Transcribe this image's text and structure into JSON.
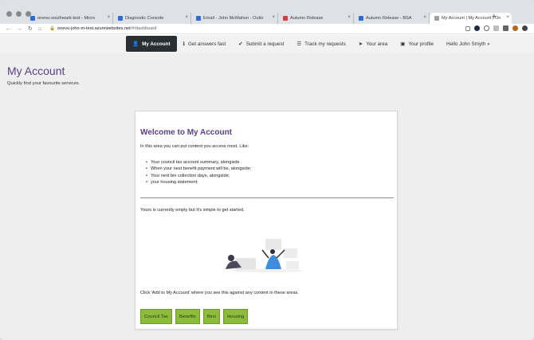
{
  "browser": {
    "tabs": [
      {
        "title": "onevu-southwark-test - Micro",
        "color": "#2f6bd8",
        "active": false
      },
      {
        "title": "Diagnostic Console",
        "color": "#2f6bd8",
        "active": false
      },
      {
        "title": "Email - John McMahon - Outlo",
        "color": "#2f6bd8",
        "active": false
      },
      {
        "title": "Autumn Release",
        "color": "#d83b3b",
        "active": false
      },
      {
        "title": "Autumn Release - BSA",
        "color": "#2f6bd8",
        "active": false
      },
      {
        "title": "My Account | My Account | On",
        "color": "#9aa0a6",
        "active": true
      }
    ],
    "close_glyph": "×",
    "new_tab_glyph": "+",
    "url_host": "onevu-john-m-test.azurewebsites.net",
    "url_path": "/#/dashboard"
  },
  "nav": {
    "items": [
      {
        "label": "My Account",
        "icon": "user-icon",
        "glyph": "👤",
        "active": true
      },
      {
        "label": "Get answers fast",
        "icon": "info-icon",
        "glyph": "ℹ",
        "active": false
      },
      {
        "label": "Submit a request",
        "icon": "check-icon",
        "glyph": "✔",
        "active": false
      },
      {
        "label": "Track my requests",
        "icon": "list-icon",
        "glyph": "☰",
        "active": false
      },
      {
        "label": "Your area",
        "icon": "location-arrow-icon",
        "glyph": "➤",
        "active": false
      },
      {
        "label": "Your profile",
        "icon": "id-card-icon",
        "glyph": "▣",
        "active": false
      }
    ],
    "greeting": "Hello John Smyth »"
  },
  "page": {
    "title": "My Account",
    "subtitle": "Quickly find your favourite services."
  },
  "card": {
    "heading": "Welcome to My Account",
    "intro": "In this area you can put content you access most. Like:",
    "list": [
      "Your council tax account summary, alongside",
      "When your next benefit payment will be, alongside;",
      "Your next bin collection days, alongside;",
      "your housing statement;"
    ],
    "empty_text": "Yours is currently empty but it's simple to get started.",
    "hint": "Click 'Add to My Account' where you see this against any content in these areas.",
    "buttons": [
      "Council Tax",
      "Benefits",
      "Bins",
      "Housing"
    ]
  },
  "colors": {
    "accent": "#5a3e8a",
    "button_green": "#8dbb3c",
    "nav_active": "#2a2f36"
  }
}
